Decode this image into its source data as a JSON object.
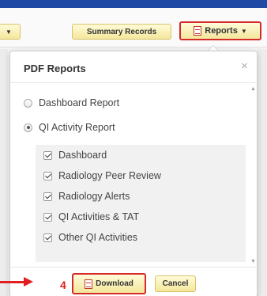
{
  "toolbar": {
    "partial_button_label": "",
    "summary_label": "Summary Records",
    "reports_label": "Reports"
  },
  "popover": {
    "title": "PDF Reports",
    "close_glyph": "×",
    "radios": [
      {
        "label": "Dashboard Report",
        "checked": false
      },
      {
        "label": "QI Activity Report",
        "checked": true
      }
    ],
    "checks": [
      {
        "label": "Dashboard",
        "checked": true
      },
      {
        "label": "Radiology Peer Review",
        "checked": true
      },
      {
        "label": "Radiology Alerts",
        "checked": true
      },
      {
        "label": "QI Activities & TAT",
        "checked": true
      },
      {
        "label": "Other QI Activities",
        "checked": true
      }
    ],
    "footer": {
      "step_number": "4",
      "download_label": "Download",
      "cancel_label": "Cancel"
    }
  },
  "colors": {
    "accent_red": "#d52a2a",
    "button_yellow": "#f4e79b",
    "top_bar_blue": "#1e4aa6"
  },
  "icons": [
    "pdf-icon",
    "caret-down-icon",
    "close-icon",
    "arrow-right-icon"
  ]
}
